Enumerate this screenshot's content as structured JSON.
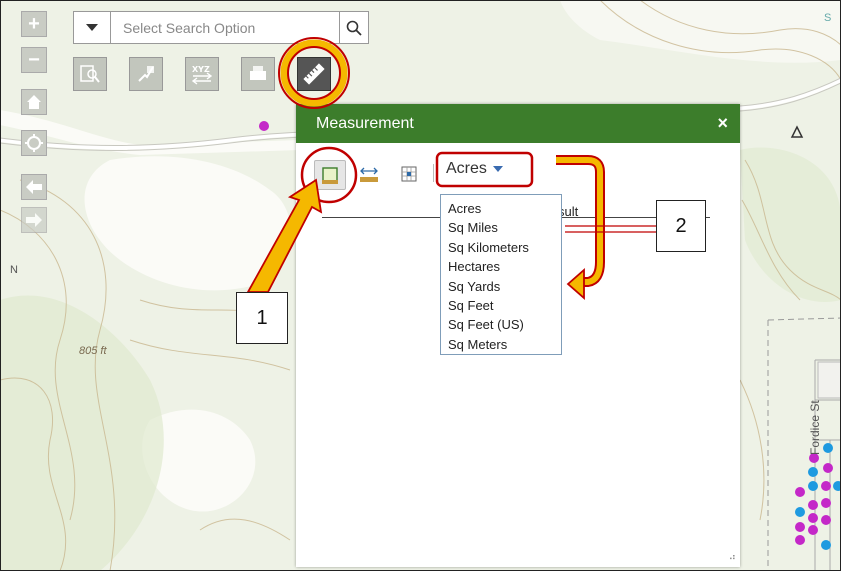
{
  "search": {
    "placeholder": "Select Search Option"
  },
  "map": {
    "elevation_label": "805 ft",
    "street_label": "Fordice St",
    "edge_letter_n": "N",
    "edge_letter_s": "S"
  },
  "nav": {
    "zoom_in": "+",
    "zoom_out": "−"
  },
  "toolbar": {
    "tools": [
      "identify-icon",
      "layer-list-icon",
      "coordinates-icon",
      "print-icon",
      "measure-ruler-icon"
    ]
  },
  "dialog": {
    "title": "Measurement",
    "close": "×",
    "tools": [
      "area-tool-icon",
      "distance-tool-icon",
      "location-tool-icon"
    ],
    "unit_selected": "Acres",
    "result_label": "sult",
    "unit_options": [
      "Acres",
      "Sq Miles",
      "Sq Kilometers",
      "Hectares",
      "Sq Yards",
      "Sq Feet",
      "Sq Feet (US)",
      "Sq Meters"
    ]
  },
  "annotations": {
    "callout_1": "1",
    "callout_2": "2"
  },
  "colors": {
    "header_green": "#3c7d2b",
    "annotation_red": "#c00000",
    "arrow_orange": "#f5b800",
    "point_magenta": "#c428c8",
    "point_blue": "#1e9ae0"
  }
}
